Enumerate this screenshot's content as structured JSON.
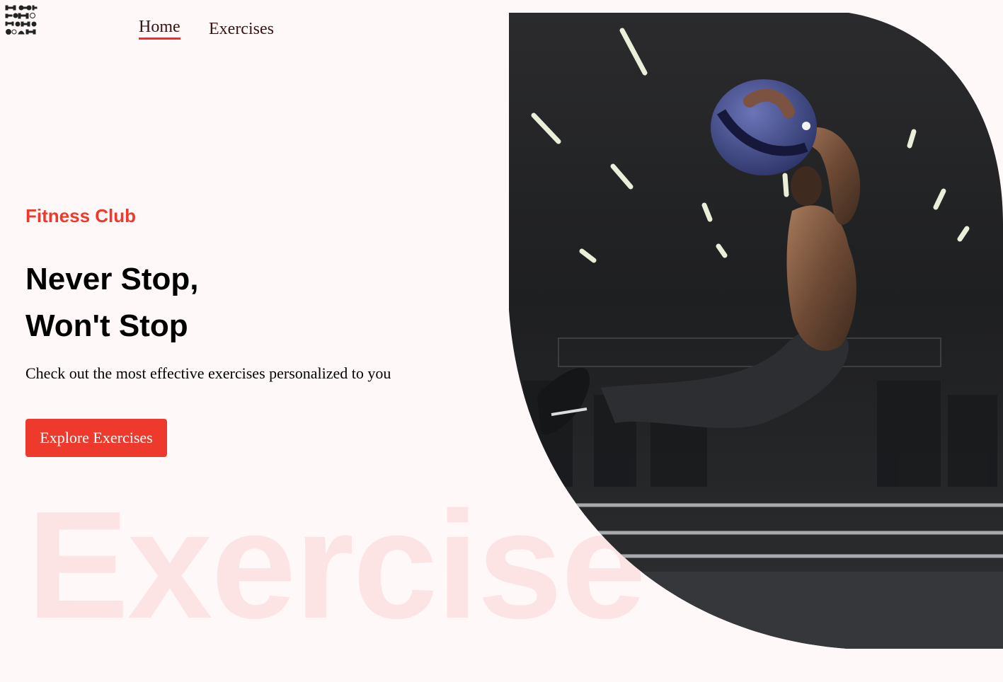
{
  "nav": {
    "logo_alt": "logo",
    "home_label": "Home",
    "exercises_label": "Exercises"
  },
  "hero": {
    "brand": "Fitness Club",
    "headline_line1": "Never Stop,",
    "headline_line2": "Won't Stop",
    "subtitle": "Check out the most effective exercises personalized to you",
    "cta_label": "Explore Exercises",
    "watermark": "Exercise",
    "image_alt": "athlete jumping with medicine ball"
  },
  "colors": {
    "accent": "#ee3a2d",
    "nav_underline": "#ff2625",
    "page_background": "#fef8f9",
    "nav_text": "#3a1212",
    "watermark": "#ef3f3f"
  },
  "icons": {
    "logo": "dumbbells-logo-icon"
  }
}
